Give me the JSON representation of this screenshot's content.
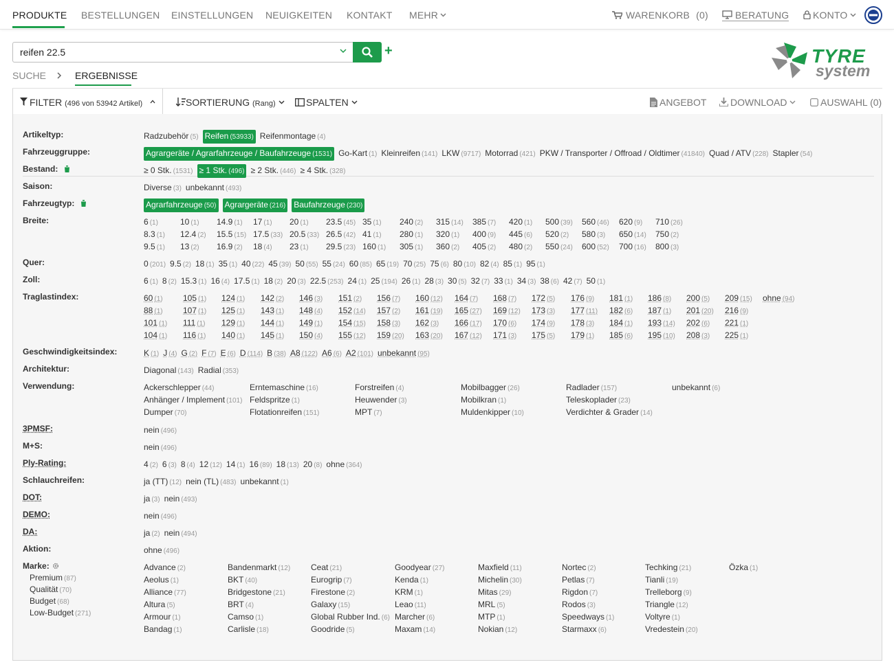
{
  "nav": {
    "items": [
      "PRODUKTE",
      "BESTELLUNGEN",
      "EINSTELLUNGEN",
      "NEUIGKEITEN",
      "KONTAKT",
      "MEHR"
    ],
    "cart_label": "WARENKORB",
    "cart_count": "(0)",
    "advice": "BERATUNG",
    "account": "KONTO"
  },
  "search": {
    "value": "reifen 22.5"
  },
  "breadcrumb": {
    "search": "SUCHE",
    "results": "ERGEBNISSE"
  },
  "logo": {
    "line1": "TYRE",
    "line2": "system"
  },
  "toolbar": {
    "filter": "FILTER",
    "filter_count": "(496 von 53942 Artikel)",
    "sort": "SORTIERUNG",
    "sort_mode": "(Rang)",
    "columns": "SPALTEN",
    "offer": "ANGEBOT",
    "download": "DOWNLOAD",
    "selection": "AUSWAHL (0)"
  },
  "colors": {
    "accent": "#1d9b4b"
  },
  "labels": {
    "artikeltyp": "Artikeltyp:",
    "fahrzeuggruppe": "Fahrzeuggruppe:",
    "bestand": "Bestand:",
    "saison": "Saison:",
    "fahrzeugtyp": "Fahrzeugtyp:",
    "breite": "Breite:",
    "quer": "Quer:",
    "zoll": "Zoll:",
    "traglast": "Traglastindex:",
    "geschw": "Geschwindigkeitsindex:",
    "architektur": "Architektur:",
    "verwendung": "Verwendung:",
    "pmsf": "3PMSF:",
    "ms": "M+S:",
    "ply": "Ply-Rating:",
    "schlauch": "Schlauchreifen:",
    "dot": "DOT:",
    "demo": "DEMO:",
    "da": "DA:",
    "aktion": "Aktion:",
    "marke": "Marke:"
  },
  "filters": {
    "artikeltyp": [
      [
        "Radzubehör",
        "(5)",
        0
      ],
      [
        "Reifen",
        "(53933)",
        1
      ],
      [
        "Reifenmontage",
        "(4)",
        0
      ]
    ],
    "fahrzeuggruppe": [
      [
        "Agrargeräte / Agrarfahrzeuge / Baufahrzeuge",
        "(1531)",
        1
      ],
      [
        "Go-Kart",
        "(1)",
        0
      ],
      [
        "Kleinreifen",
        "(141)",
        0
      ],
      [
        "LKW",
        "(9717)",
        0
      ],
      [
        "Motorrad",
        "(421)",
        0
      ],
      [
        "PKW / Transporter / Offroad / Oldtimer",
        "(41840)",
        0
      ],
      [
        "Quad / ATV",
        "(228)",
        0
      ],
      [
        "Stapler",
        "(54)",
        0
      ]
    ],
    "bestand": [
      [
        "≥ 0 Stk.",
        "(1531)",
        0
      ],
      [
        "≥ 1 Stk.",
        "(496)",
        1
      ],
      [
        "≥ 2 Stk.",
        "(446)",
        0
      ],
      [
        "≥ 4 Stk.",
        "(328)",
        0
      ]
    ],
    "saison": [
      [
        "Diverse",
        "(3)",
        0
      ],
      [
        "unbekannt",
        "(493)",
        0
      ]
    ],
    "fahrzeugtyp": [
      [
        "Agrarfahrzeuge",
        "(50)",
        1
      ],
      [
        "Agrargeräte",
        "(216)",
        1
      ],
      [
        "Baufahrzeuge",
        "(230)",
        1
      ]
    ],
    "quer": [
      [
        "0",
        "(201)"
      ],
      [
        "9.5",
        "(2)"
      ],
      [
        "18",
        "(1)"
      ],
      [
        "35",
        "(1)"
      ],
      [
        "40",
        "(22)"
      ],
      [
        "45",
        "(39)"
      ],
      [
        "50",
        "(55)"
      ],
      [
        "55",
        "(24)"
      ],
      [
        "60",
        "(85)"
      ],
      [
        "65",
        "(19)"
      ],
      [
        "70",
        "(25)"
      ],
      [
        "75",
        "(6)"
      ],
      [
        "80",
        "(10)"
      ],
      [
        "82",
        "(4)"
      ],
      [
        "85",
        "(1)"
      ],
      [
        "95",
        "(1)"
      ]
    ],
    "zoll": [
      [
        "6",
        "(1)"
      ],
      [
        "8",
        "(2)"
      ],
      [
        "15.3",
        "(1)"
      ],
      [
        "16",
        "(4)"
      ],
      [
        "17.5",
        "(1)"
      ],
      [
        "18",
        "(2)"
      ],
      [
        "20",
        "(3)"
      ],
      [
        "22.5",
        "(253)"
      ],
      [
        "24",
        "(1)"
      ],
      [
        "25",
        "(194)"
      ],
      [
        "26",
        "(1)"
      ],
      [
        "28",
        "(3)"
      ],
      [
        "30",
        "(5)"
      ],
      [
        "32",
        "(7)"
      ],
      [
        "33",
        "(1)"
      ],
      [
        "34",
        "(3)"
      ],
      [
        "38",
        "(6)"
      ],
      [
        "42",
        "(7)"
      ],
      [
        "50",
        "(1)"
      ]
    ],
    "geschw": [
      [
        "K",
        "(1)"
      ],
      [
        "J",
        "(4)"
      ],
      [
        "G",
        "(2)"
      ],
      [
        "F",
        "(7)"
      ],
      [
        "E",
        "(6)"
      ],
      [
        "D",
        "(114)"
      ],
      [
        "B",
        "(38)"
      ],
      [
        "A8",
        "(122)"
      ],
      [
        "A6",
        "(6)"
      ],
      [
        "A2",
        "(101)"
      ],
      [
        "unbekannt",
        "(95)"
      ]
    ],
    "architektur": [
      [
        "Diagonal",
        "(143)"
      ],
      [
        "Radial",
        "(353)"
      ]
    ],
    "pmsf": [
      [
        "nein",
        "(496)"
      ]
    ],
    "ms": [
      [
        "nein",
        "(496)"
      ]
    ],
    "ply": [
      [
        "4",
        "(2)"
      ],
      [
        "6",
        "(3)"
      ],
      [
        "8",
        "(4)"
      ],
      [
        "12",
        "(12)"
      ],
      [
        "14",
        "(1)"
      ],
      [
        "16",
        "(89)"
      ],
      [
        "18",
        "(13)"
      ],
      [
        "20",
        "(8)"
      ],
      [
        "ohne",
        "(364)"
      ]
    ],
    "schlauch": [
      [
        "ja (TT)",
        "(12)"
      ],
      [
        "nein (TL)",
        "(483)"
      ],
      [
        "unbekannt",
        "(1)"
      ]
    ],
    "dot": [
      [
        "ja",
        "(3)"
      ],
      [
        "nein",
        "(493)"
      ]
    ],
    "demo": [
      [
        "nein",
        "(496)"
      ]
    ],
    "da": [
      [
        "ja",
        "(2)"
      ],
      [
        "nein",
        "(494)"
      ]
    ],
    "aktion": [
      [
        "ohne",
        "(496)"
      ]
    ]
  },
  "breite": [
    [
      [
        "6",
        "(1)"
      ],
      [
        "8.3",
        "(1)"
      ],
      [
        "9.5",
        "(1)"
      ]
    ],
    [
      [
        "10",
        "(1)"
      ],
      [
        "12.4",
        "(2)"
      ],
      [
        "13",
        "(2)"
      ]
    ],
    [
      [
        "14.9",
        "(1)"
      ],
      [
        "15.5",
        "(15)"
      ],
      [
        "16.9",
        "(2)"
      ]
    ],
    [
      [
        "17",
        "(1)"
      ],
      [
        "17.5",
        "(33)"
      ],
      [
        "18",
        "(4)"
      ]
    ],
    [
      [
        "20",
        "(1)"
      ],
      [
        "20.5",
        "(33)"
      ],
      [
        "23",
        "(1)"
      ]
    ],
    [
      [
        "23.5",
        "(45)"
      ],
      [
        "26.5",
        "(42)"
      ],
      [
        "29.5",
        "(23)"
      ]
    ],
    [
      [
        "35",
        "(1)"
      ],
      [
        "41",
        "(1)"
      ],
      [
        "160",
        "(1)"
      ]
    ],
    [
      [
        "240",
        "(2)"
      ],
      [
        "280",
        "(1)"
      ],
      [
        "305",
        "(1)"
      ]
    ],
    [
      [
        "315",
        "(14)"
      ],
      [
        "320",
        "(1)"
      ],
      [
        "360",
        "(2)"
      ]
    ],
    [
      [
        "385",
        "(7)"
      ],
      [
        "400",
        "(9)"
      ],
      [
        "405",
        "(2)"
      ]
    ],
    [
      [
        "420",
        "(1)"
      ],
      [
        "445",
        "(6)"
      ],
      [
        "480",
        "(2)"
      ]
    ],
    [
      [
        "500",
        "(39)"
      ],
      [
        "520",
        "(2)"
      ],
      [
        "550",
        "(24)"
      ]
    ],
    [
      [
        "560",
        "(46)"
      ],
      [
        "580",
        "(3)"
      ],
      [
        "600",
        "(52)"
      ]
    ],
    [
      [
        "620",
        "(9)"
      ],
      [
        "650",
        "(14)"
      ],
      [
        "700",
        "(16)"
      ]
    ],
    [
      [
        "710",
        "(26)"
      ],
      [
        "750",
        "(2)"
      ],
      [
        "800",
        "(3)"
      ]
    ]
  ],
  "traglast": [
    [
      [
        "60",
        "(1)"
      ],
      [
        "88",
        "(1)"
      ],
      [
        "101",
        "(1)"
      ],
      [
        "104",
        "(1)"
      ]
    ],
    [
      [
        "105",
        "(1)"
      ],
      [
        "107",
        "(1)"
      ],
      [
        "111",
        "(1)"
      ],
      [
        "116",
        "(1)"
      ]
    ],
    [
      [
        "124",
        "(1)"
      ],
      [
        "125",
        "(1)"
      ],
      [
        "129",
        "(1)"
      ],
      [
        "140",
        "(1)"
      ]
    ],
    [
      [
        "142",
        "(2)"
      ],
      [
        "143",
        "(1)"
      ],
      [
        "144",
        "(1)"
      ],
      [
        "145",
        "(1)"
      ]
    ],
    [
      [
        "146",
        "(3)"
      ],
      [
        "148",
        "(4)"
      ],
      [
        "149",
        "(1)"
      ],
      [
        "150",
        "(4)"
      ]
    ],
    [
      [
        "151",
        "(2)"
      ],
      [
        "152",
        "(14)"
      ],
      [
        "154",
        "(15)"
      ],
      [
        "155",
        "(12)"
      ]
    ],
    [
      [
        "156",
        "(7)"
      ],
      [
        "157",
        "(2)"
      ],
      [
        "158",
        "(3)"
      ],
      [
        "159",
        "(20)"
      ]
    ],
    [
      [
        "160",
        "(12)"
      ],
      [
        "161",
        "(19)"
      ],
      [
        "162",
        "(3)"
      ],
      [
        "163",
        "(20)"
      ]
    ],
    [
      [
        "164",
        "(7)"
      ],
      [
        "165",
        "(27)"
      ],
      [
        "166",
        "(17)"
      ],
      [
        "167",
        "(12)"
      ]
    ],
    [
      [
        "168",
        "(7)"
      ],
      [
        "169",
        "(12)"
      ],
      [
        "170",
        "(6)"
      ],
      [
        "171",
        "(3)"
      ]
    ],
    [
      [
        "172",
        "(5)"
      ],
      [
        "173",
        "(3)"
      ],
      [
        "174",
        "(9)"
      ],
      [
        "175",
        "(5)"
      ]
    ],
    [
      [
        "176",
        "(9)"
      ],
      [
        "177",
        "(11)"
      ],
      [
        "178",
        "(3)"
      ],
      [
        "179",
        "(1)"
      ]
    ],
    [
      [
        "181",
        "(1)"
      ],
      [
        "182",
        "(6)"
      ],
      [
        "184",
        "(1)"
      ],
      [
        "185",
        "(6)"
      ]
    ],
    [
      [
        "186",
        "(8)"
      ],
      [
        "187",
        "(1)"
      ],
      [
        "193",
        "(14)"
      ],
      [
        "195",
        "(10)"
      ]
    ],
    [
      [
        "200",
        "(5)"
      ],
      [
        "201",
        "(20)"
      ],
      [
        "202",
        "(6)"
      ],
      [
        "208",
        "(3)"
      ]
    ],
    [
      [
        "209",
        "(15)"
      ],
      [
        "216",
        "(9)"
      ],
      [
        "221",
        "(1)"
      ],
      [
        "225",
        "(1)"
      ]
    ],
    [
      [
        "ohne",
        "(94)"
      ]
    ]
  ],
  "verwendung": [
    [
      [
        "Ackerschlepper",
        "(44)"
      ],
      [
        "Anhänger / Implement",
        "(101)"
      ],
      [
        "Dumper",
        "(70)"
      ]
    ],
    [
      [
        "Erntemaschine",
        "(16)"
      ],
      [
        "Feldspritze",
        "(1)"
      ],
      [
        "Flotationreifen",
        "(151)"
      ]
    ],
    [
      [
        "Forstreifen",
        "(4)"
      ],
      [
        "Heuwender",
        "(3)"
      ],
      [
        "MPT",
        "(7)"
      ]
    ],
    [
      [
        "Mobilbagger",
        "(26)"
      ],
      [
        "Mobilkran",
        "(1)"
      ],
      [
        "Muldenkipper",
        "(10)"
      ]
    ],
    [
      [
        "Radlader",
        "(157)"
      ],
      [
        "Teleskoplader",
        "(23)"
      ],
      [
        "Verdichter & Grader",
        "(14)"
      ]
    ],
    [
      [
        "unbekannt",
        "(6)"
      ]
    ]
  ],
  "tiers": [
    [
      "Premium",
      "(87)"
    ],
    [
      "Qualität",
      "(70)"
    ],
    [
      "Budget",
      "(68)"
    ],
    [
      "Low-Budget",
      "(271)"
    ]
  ],
  "marke": [
    [
      [
        "Advance",
        "(2)"
      ],
      [
        "Aeolus",
        "(1)"
      ],
      [
        "Alliance",
        "(77)"
      ],
      [
        "Altura",
        "(5)"
      ],
      [
        "Armour",
        "(1)"
      ],
      [
        "Bandag",
        "(1)"
      ]
    ],
    [
      [
        "Bandenmarkt",
        "(12)"
      ],
      [
        "BKT",
        "(40)"
      ],
      [
        "Bridgestone",
        "(21)"
      ],
      [
        "BRT",
        "(4)"
      ],
      [
        "Camso",
        "(1)"
      ],
      [
        "Carlisle",
        "(18)"
      ]
    ],
    [
      [
        "Ceat",
        "(21)"
      ],
      [
        "Eurogrip",
        "(7)"
      ],
      [
        "Firestone",
        "(2)"
      ],
      [
        "Galaxy",
        "(15)"
      ],
      [
        "Global Rubber Ind.",
        "(6)"
      ],
      [
        "Goodride",
        "(5)"
      ]
    ],
    [
      [
        "Goodyear",
        "(27)"
      ],
      [
        "Kenda",
        "(1)"
      ],
      [
        "KRM",
        "(1)"
      ],
      [
        "Leao",
        "(11)"
      ],
      [
        "Marcher",
        "(6)"
      ],
      [
        "Maxam",
        "(14)"
      ]
    ],
    [
      [
        "Maxfield",
        "(11)"
      ],
      [
        "Michelin",
        "(30)"
      ],
      [
        "Mitas",
        "(29)"
      ],
      [
        "MRL",
        "(5)"
      ],
      [
        "MTP",
        "(1)"
      ],
      [
        "Nokian",
        "(12)"
      ]
    ],
    [
      [
        "Nortec",
        "(2)"
      ],
      [
        "Petlas",
        "(7)"
      ],
      [
        "Rigdon",
        "(7)"
      ],
      [
        "Rodos",
        "(3)"
      ],
      [
        "Speedways",
        "(1)"
      ],
      [
        "Starmaxx",
        "(6)"
      ]
    ],
    [
      [
        "Techking",
        "(21)"
      ],
      [
        "Tianli",
        "(19)"
      ],
      [
        "Trelleborg",
        "(9)"
      ],
      [
        "Triangle",
        "(12)"
      ],
      [
        "Voltyre",
        "(1)"
      ],
      [
        "Vredestein",
        "(20)"
      ]
    ],
    [
      [
        "Özka",
        "(1)"
      ]
    ]
  ]
}
